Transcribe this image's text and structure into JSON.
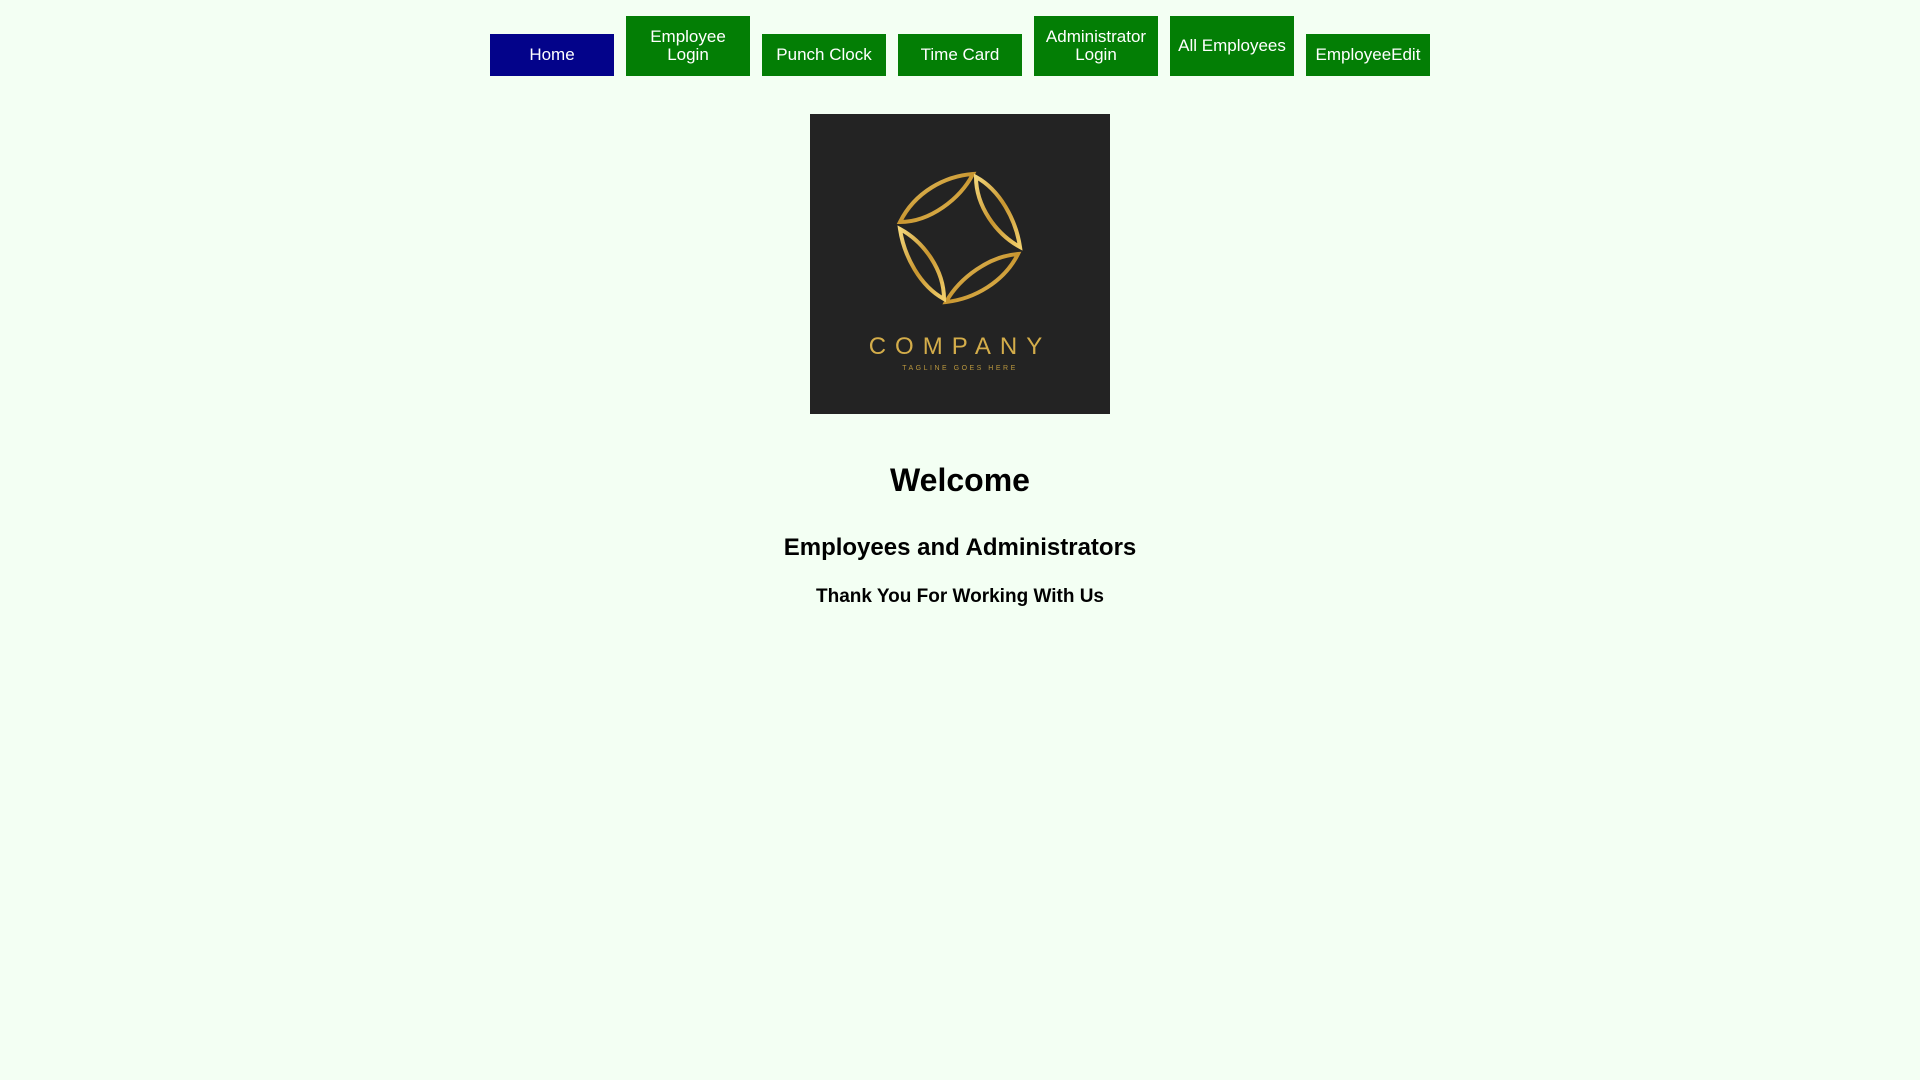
{
  "nav": {
    "items": [
      {
        "label": "Home",
        "active": true
      },
      {
        "label": "Employee Login",
        "active": false
      },
      {
        "label": "Punch Clock",
        "active": false
      },
      {
        "label": "Time Card",
        "active": false
      },
      {
        "label": "Administrator Login",
        "active": false
      },
      {
        "label": "All Employees",
        "active": false
      },
      {
        "label": "EmployeeEdit",
        "active": false
      }
    ]
  },
  "logo": {
    "company": "COMPANY",
    "tagline": "TAGLINE GOES HERE"
  },
  "main": {
    "welcome": "Welcome",
    "subtitle": "Employees and Administrators",
    "thanks": "Thank You For Working With Us"
  },
  "colors": {
    "background": "#f3fff3",
    "nav_default": "#037e05",
    "nav_active": "#03038a",
    "logo_bg": "#232323",
    "logo_gold": "#d4ad4a"
  }
}
